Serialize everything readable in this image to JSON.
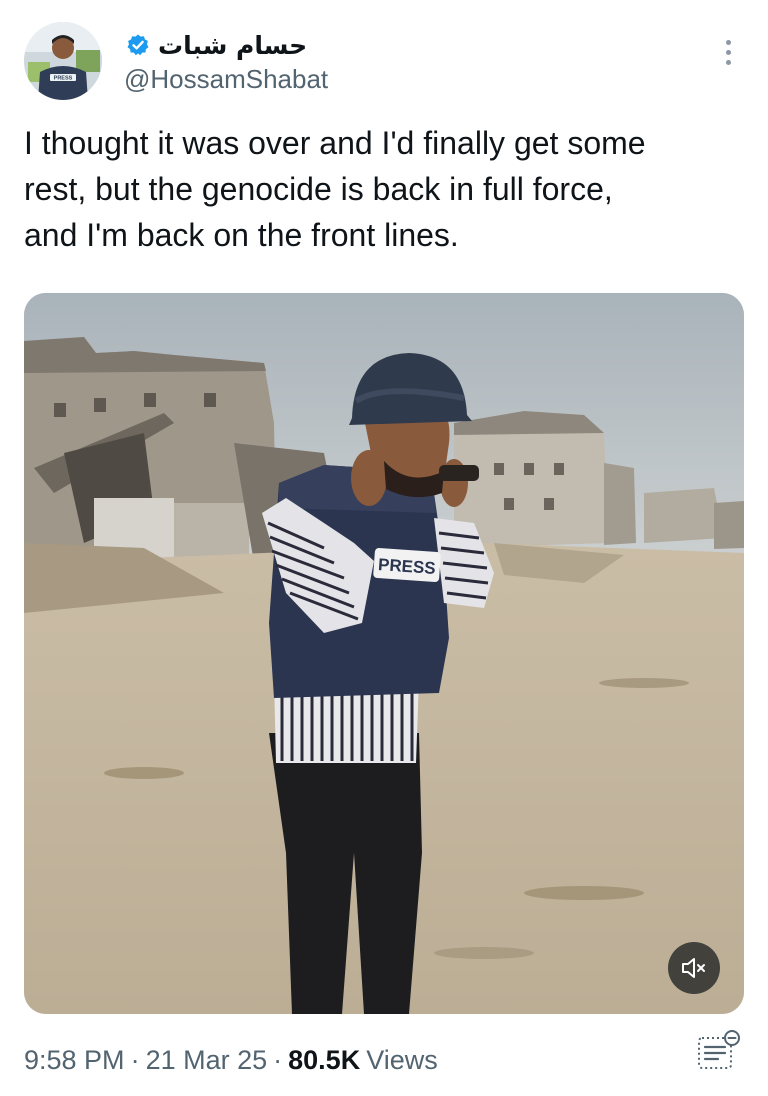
{
  "author": {
    "display_name": "حسام شبات",
    "handle": "@HossamShabat",
    "verified": true,
    "avatar_badge_text": "PRESS"
  },
  "tweet": {
    "text": "I thought it was over and I'd finally get some\nrest, but the genocide is back in full force,\nand I'm back on the front lines."
  },
  "media": {
    "vest_label": "PRESS",
    "mute_icon": "speaker-muted-icon"
  },
  "meta": {
    "time": "9:58 PM",
    "separator": "·",
    "date": "21 Mar 25",
    "views_count": "80.5K",
    "views_label": "Views"
  },
  "colors": {
    "text_primary": "#0f1419",
    "text_secondary": "#536471",
    "verified_blue": "#1d9bf0"
  },
  "icons": {
    "verified": "verified-badge-icon",
    "more": "more-options-icon",
    "stats": "post-stats-icon"
  }
}
